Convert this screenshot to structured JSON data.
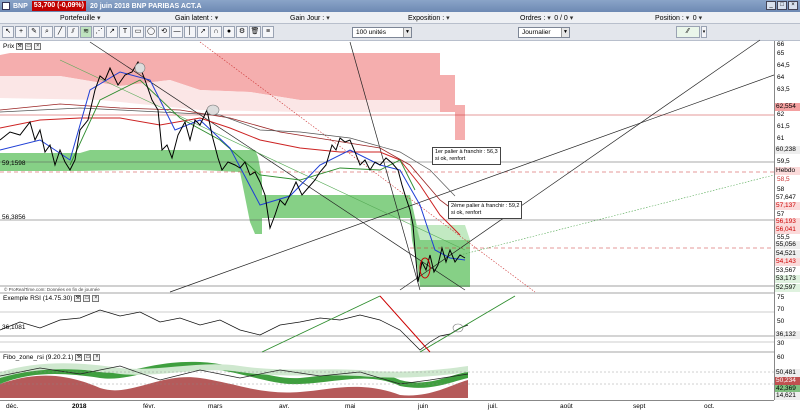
{
  "window": {
    "symbol": "BNP",
    "price": "53,700 (-0,09%)",
    "description": "20 juin 2018 BNP PARIBAS ACT.A"
  },
  "infobar": {
    "portefeuille": "Portefeuille",
    "gain_latent": "Gain latent :",
    "gain_jour": "Gain Jour :",
    "exposition": "Exposition :",
    "ordres_label": "Ordres :",
    "ordres_value": "0 / 0",
    "position_label": "Position :",
    "position_value": "0"
  },
  "toolbar": {
    "quantity": "100 unités",
    "period": "Journalier"
  },
  "price_panel": {
    "title": "Prix",
    "credit": "© ProRealTime.com: Données en fin de journée",
    "left_label_top": "59,1598",
    "left_label_bottom": "56,3856",
    "note_1": {
      "line1": "2ème palier à franchir : 59,2",
      "line2": "si ok, renfort"
    },
    "note_2": {
      "line1": "1er palier à franchir : 56,3",
      "line2": "si ok, renfort"
    },
    "axis_labels": [
      "66",
      "65",
      "64,5",
      "64",
      "63,5",
      "63",
      "62,554",
      "62",
      "61,5",
      "61",
      "60,5",
      "60,238",
      "60",
      "59,5",
      "59",
      "58,5",
      "58",
      "57,647",
      "57,5",
      "57,137",
      "57",
      "56,5",
      "56,193",
      "56,041",
      "56",
      "55,5",
      "55,056",
      "55",
      "54,521",
      "54,5",
      "54,143",
      "54",
      "53,567",
      "53,5",
      "53,173",
      "53",
      "52,597"
    ],
    "hebdo": "Hebdo"
  },
  "rsi_panel": {
    "title": "Exemple RSI (14.75.30)",
    "left_label": "36,1081",
    "axis_labels": [
      "75",
      "70",
      "50",
      "36,132",
      "30",
      "0"
    ]
  },
  "fibo_panel": {
    "title": "Fibo_zone_rsi (9.20.2.1)",
    "axis_labels": [
      "60",
      "50,481",
      "50,234",
      "42,369",
      "40",
      "30",
      "14,621"
    ]
  },
  "time_axis": [
    "déc.",
    "2018",
    "févr.",
    "mars",
    "avr.",
    "mai",
    "juin",
    "juil.",
    "août",
    "sept",
    "oct."
  ],
  "colors": {
    "cloud_red": "#f08080",
    "cloud_green": "#6cc26c",
    "price_line": "#000000",
    "ma_blue": "#1f3fd6",
    "ma_red": "#cc2222"
  }
}
